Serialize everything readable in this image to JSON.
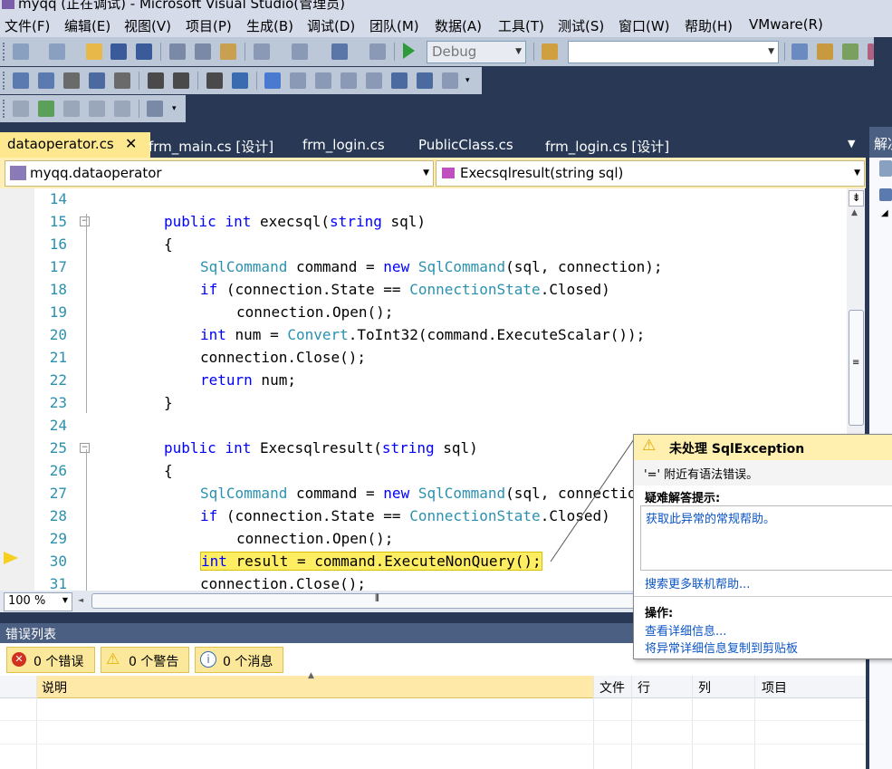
{
  "window": {
    "title": "myqq (正在调试) - Microsoft Visual Studio(管理员)"
  },
  "menu": [
    "文件(F)",
    "编辑(E)",
    "视图(V)",
    "项目(P)",
    "生成(B)",
    "调试(D)",
    "团队(M)",
    "数据(A)",
    "工具(T)",
    "测试(S)",
    "窗口(W)",
    "帮助(H)",
    "VMware(R)"
  ],
  "toolbar": {
    "config": "Debug",
    "search": ""
  },
  "tabs": [
    "dataoperator.cs",
    "frm_main.cs [设计]",
    "frm_login.cs",
    "PublicClass.cs",
    "frm_login.cs [设计]"
  ],
  "right_tab": "解决",
  "nav": {
    "class_combo": "myqq.dataoperator",
    "member_combo": "Execsqlresult(string sql)"
  },
  "code_lines": [
    {
      "n": "14"
    },
    {
      "n": "15"
    },
    {
      "n": "16"
    },
    {
      "n": "17"
    },
    {
      "n": "18"
    },
    {
      "n": "19"
    },
    {
      "n": "20"
    },
    {
      "n": "21"
    },
    {
      "n": "22"
    },
    {
      "n": "23"
    },
    {
      "n": "24"
    },
    {
      "n": "25"
    },
    {
      "n": "26"
    },
    {
      "n": "27"
    },
    {
      "n": "28"
    },
    {
      "n": "29"
    },
    {
      "n": "30"
    },
    {
      "n": "31"
    }
  ],
  "zoom": "100 %",
  "errorlist": {
    "title": "错误列表",
    "errors": "0 个错误",
    "warnings": "0 个警告",
    "messages": "0 个消息",
    "columns": {
      "desc": "说明",
      "file": "文件",
      "line": "行",
      "col": "列",
      "project": "项目"
    }
  },
  "exception": {
    "title": "未处理 SqlException",
    "message": "'=' 附近有语法错误。",
    "tips_header": "疑难解答提示:",
    "tip_link": "获取此异常的常规帮助。",
    "search_link": "搜索更多联机帮助...",
    "actions_header": "操作:",
    "action1": "查看详细信息...",
    "action2": "将异常详细信息复制到剪贴板"
  }
}
